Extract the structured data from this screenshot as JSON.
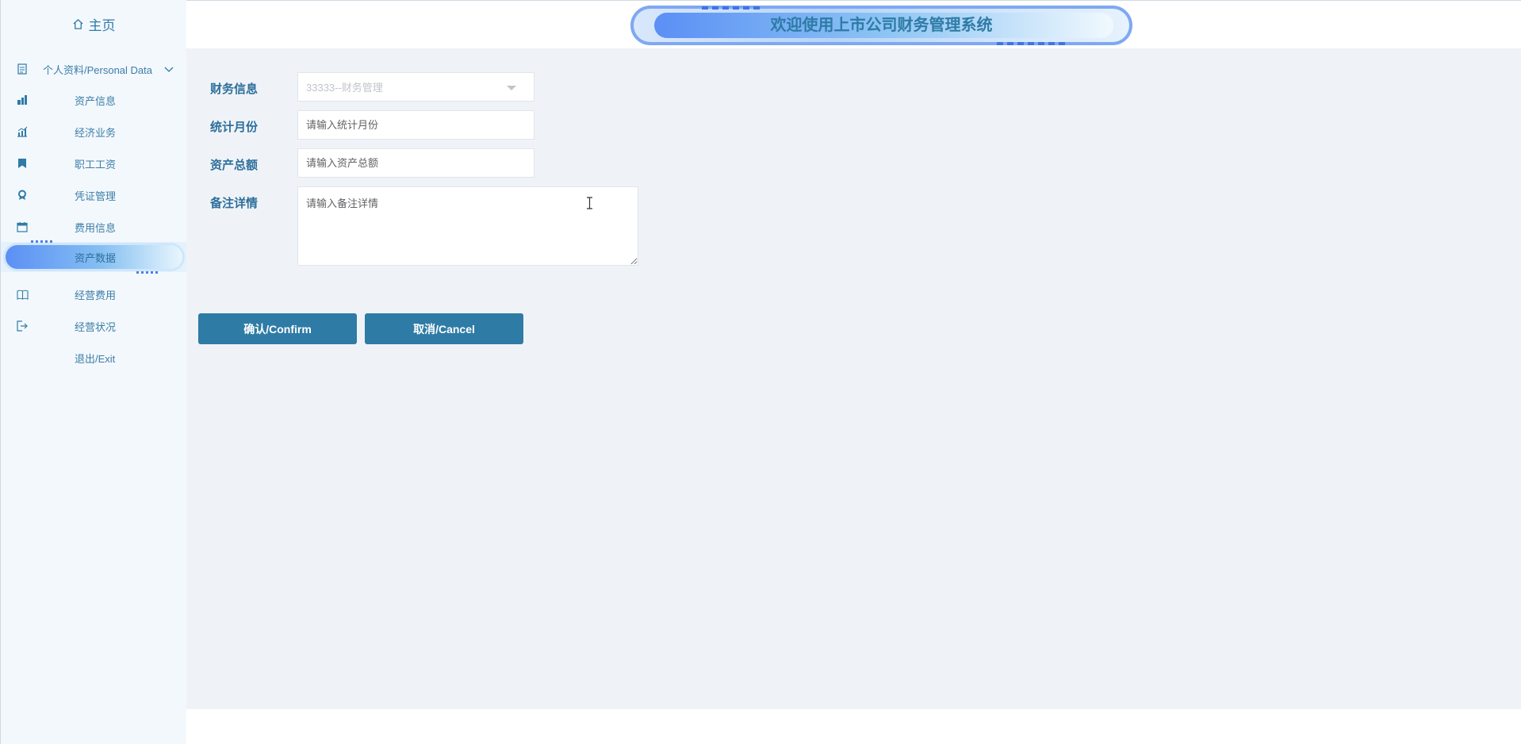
{
  "sidebar": {
    "home_label": "主页",
    "items": [
      {
        "label": "个人资料/Personal Data",
        "icon": "document-icon"
      },
      {
        "label": "资产信息",
        "icon": "building-chart-icon"
      },
      {
        "label": "经济业务",
        "icon": "bar-chart-icon"
      },
      {
        "label": "职工工资",
        "icon": "bookmark-icon"
      },
      {
        "label": "凭证管理",
        "icon": "award-icon"
      },
      {
        "label": "费用信息",
        "icon": "calendar-icon"
      },
      {
        "label": "资产数据",
        "icon": "",
        "active": true
      },
      {
        "label": "经营费用",
        "icon": "open-book-icon"
      },
      {
        "label": "经营状况",
        "icon": "exit-door-icon"
      },
      {
        "label": "退出/Exit",
        "icon": ""
      }
    ]
  },
  "header": {
    "title": "欢迎使用上市公司财务管理系统"
  },
  "form": {
    "finance_label": "财务信息",
    "finance_value": "33333--财务管理",
    "month_label": "统计月份",
    "month_placeholder": "请输入统计月份",
    "assets_label": "资产总额",
    "assets_placeholder": "请输入资产总额",
    "remarks_label": "备注详情",
    "remarks_placeholder": "请输入备注详情"
  },
  "buttons": {
    "confirm": "确认/Confirm",
    "cancel": "取消/Cancel"
  },
  "colors": {
    "primary": "#2e7ba6",
    "sidebar_bg": "#f3f8fd",
    "main_bg": "#eff3f7"
  }
}
